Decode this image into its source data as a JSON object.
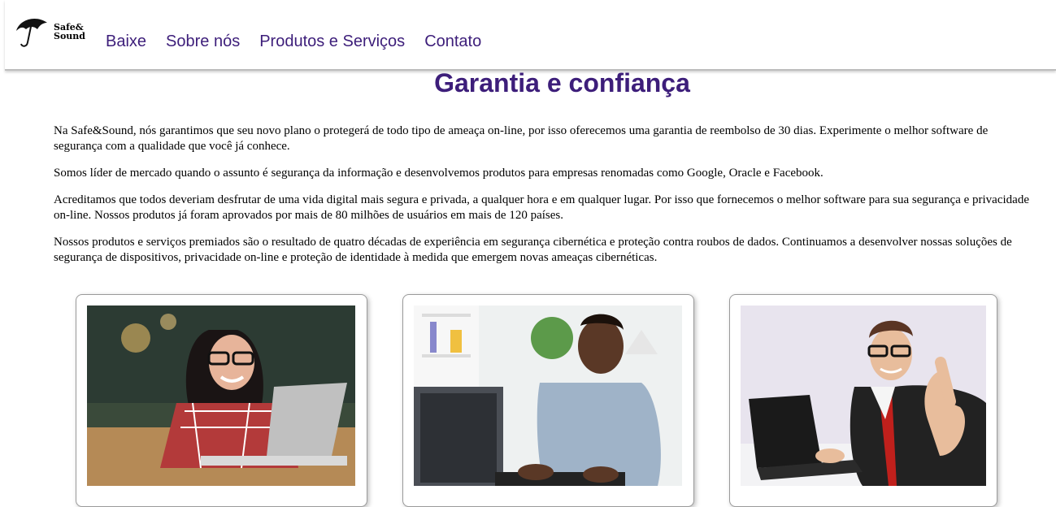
{
  "logo": {
    "line1": "Safe&",
    "line2": "Sound",
    "icon": "umbrella-icon"
  },
  "nav": [
    "Baixe",
    "Sobre nós",
    "Produtos e Serviços",
    "Contato"
  ],
  "title": "Garantia e confiança",
  "paragraphs": [
    "Na Safe&Sound, nós garantimos que seu novo plano o protegerá de todo tipo de ameaça on-line, por isso oferecemos uma garantia de reembolso de 30 dias. Experimente o melhor software de segurança com a qualidade que você já conhece.",
    "Somos líder de mercado quando o assunto é segurança da informação e desenvolvemos produtos para empresas renomadas como Google, Oracle e Facebook.",
    "Acreditamos que todos deveriam desfrutar de uma vida digital mais segura e privada, a qualquer hora e em qualquer lugar. Por isso que fornecemos o melhor software para sua segurança e privacidade on-line. Nossos produtos já foram aprovados por mais de 80 milhões de usuários em mais de 120 países.",
    "Nossos produtos e serviços premiados são o resultado de quatro décadas de experiência em segurança cibernética e proteção contra roubos de dados. Continuamos a desenvolver nossas soluções de segurança de dispositivos, privacidade on-line e proteção de identidade à medida que emergem novas ameaças cibernéticas."
  ],
  "colors": {
    "accent": "#3d1e7a"
  }
}
